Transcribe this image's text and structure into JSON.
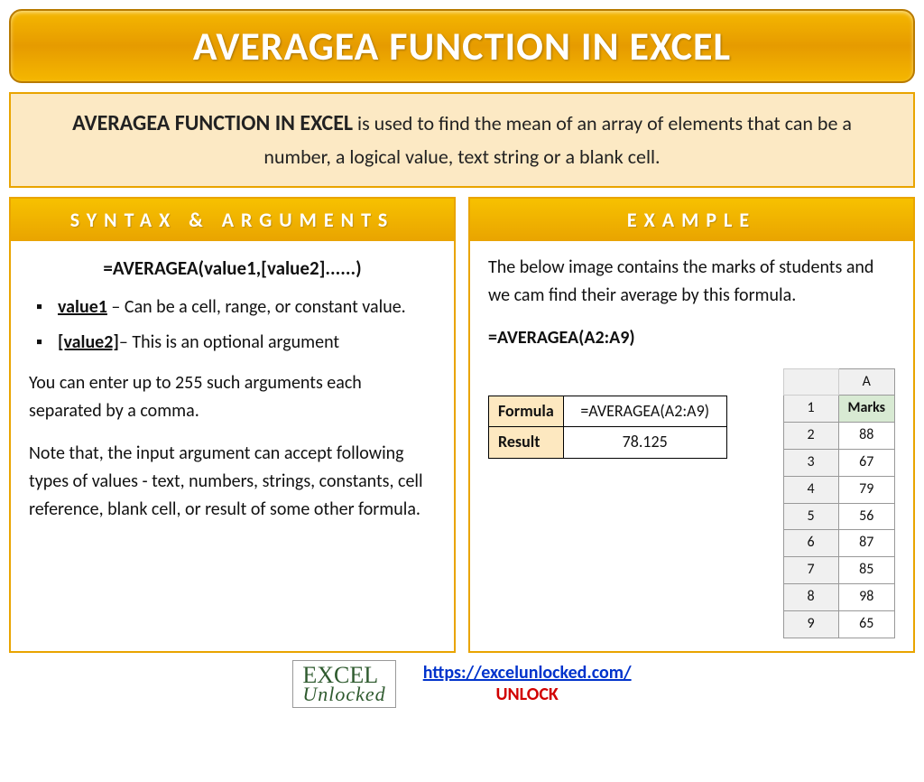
{
  "title": "AVERAGEA FUNCTION IN EXCEL",
  "description": {
    "lead": "AVERAGEA FUNCTION IN EXCEL",
    "rest": " is used to find the mean of an array of elements that can be a number, a logical value, text string or a blank cell."
  },
  "syntax": {
    "header": "SYNTAX & ARGUMENTS",
    "formula": "=AVERAGEA(value1,[value2]......)",
    "args": [
      {
        "name": "value1",
        "desc": " – Can be a cell, range, or constant value."
      },
      {
        "name": "[value2]",
        "desc": "– This is an optional argument"
      }
    ],
    "para1": "You can enter up to 255 such arguments each separated by a comma.",
    "para2": "Note that, the input argument can accept following types of values - text, numbers, strings, constants, cell reference, blank cell, or result of some other formula."
  },
  "example": {
    "header": "EXAMPLE",
    "intro": "The below image contains the marks of students and we cam find their average by this formula.",
    "formula": "=AVERAGEA(A2:A9)",
    "resultTable": {
      "formulaLabel": "Formula",
      "formulaValue": "=AVERAGEA(A2:A9)",
      "resultLabel": "Result",
      "resultValue": "78.125"
    },
    "sheet": {
      "colLetter": "A",
      "headerCell": "Marks",
      "rows": [
        {
          "n": "1",
          "v": "Marks"
        },
        {
          "n": "2",
          "v": "88"
        },
        {
          "n": "3",
          "v": "67"
        },
        {
          "n": "4",
          "v": "79"
        },
        {
          "n": "5",
          "v": "56"
        },
        {
          "n": "6",
          "v": "87"
        },
        {
          "n": "7",
          "v": "85"
        },
        {
          "n": "8",
          "v": "98"
        },
        {
          "n": "9",
          "v": "65"
        }
      ]
    }
  },
  "footer": {
    "logoLine1": "EXCEL",
    "logoLine2": "Unlocked",
    "url": "https://excelunlocked.com/",
    "unlock": "UNLOCK"
  }
}
